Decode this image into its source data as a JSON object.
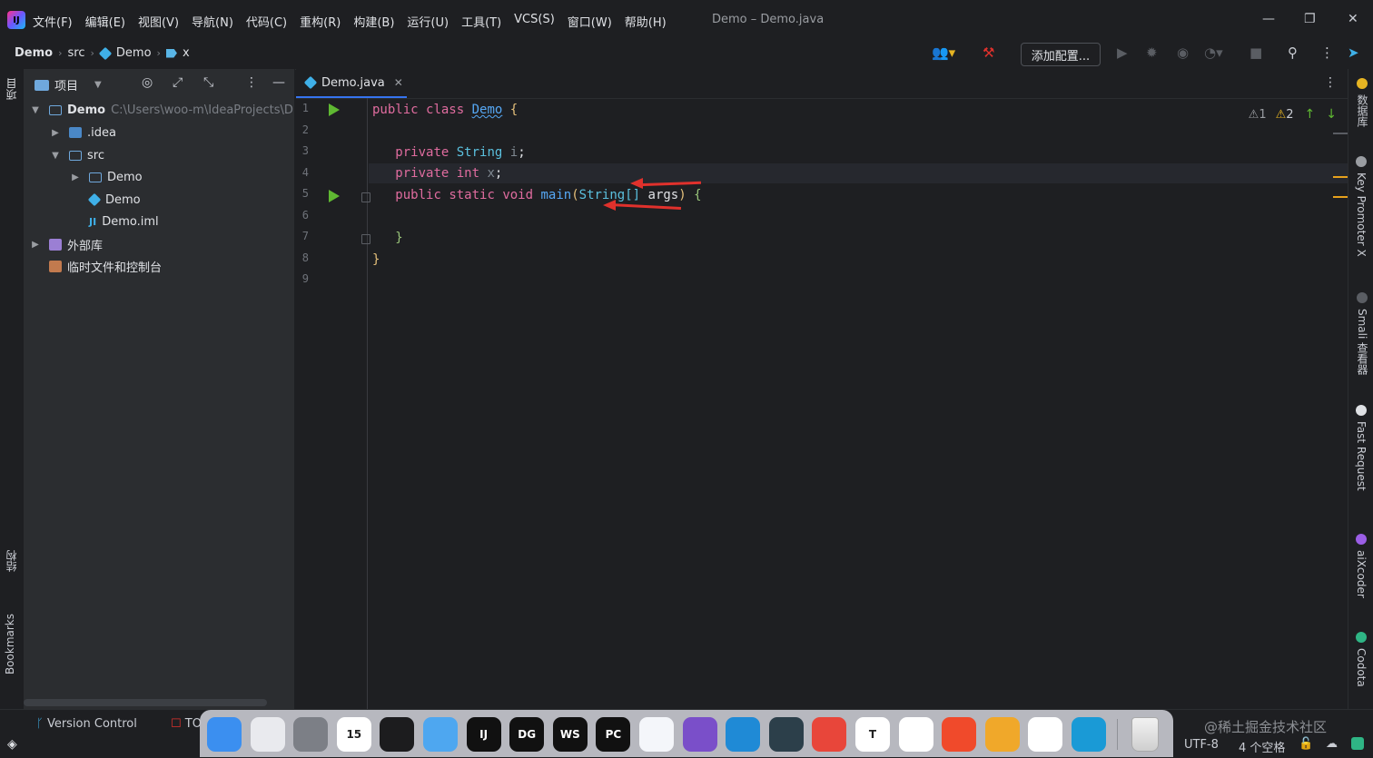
{
  "menu": [
    "文件(F)",
    "编辑(E)",
    "视图(V)",
    "导航(N)",
    "代码(C)",
    "重构(R)",
    "构建(B)",
    "运行(U)",
    "工具(T)",
    "VCS(S)",
    "窗口(W)",
    "帮助(H)"
  ],
  "window_title": "Demo – Demo.java",
  "app_logo": "IJ",
  "breadcrumb": [
    "Demo",
    "src",
    "Demo",
    "x"
  ],
  "toolbar": {
    "add_config_label": "添加配置..."
  },
  "left_strip": {
    "project_label": "项目",
    "structure_label": "结构",
    "bookmarks_label": "Bookmarks"
  },
  "project_panel": {
    "title": "项目",
    "tree": [
      {
        "label": "Demo",
        "path": "C:\\Users\\woo-m\\IdeaProjects\\D",
        "expanded": true
      },
      {
        "label": ".idea"
      },
      {
        "label": "src",
        "expanded": true
      },
      {
        "label": "Demo"
      },
      {
        "label": "Demo"
      },
      {
        "label": "Demo.iml"
      },
      {
        "label": "外部库"
      },
      {
        "label": "临时文件和控制台"
      }
    ]
  },
  "editor": {
    "tab_label": "Demo.java",
    "line_numbers": [
      "1",
      "2",
      "3",
      "4",
      "5",
      "6",
      "7",
      "8",
      "9"
    ],
    "code": {
      "l1_kw1": "public",
      "l1_kw2": "class",
      "l1_cls": "Demo",
      "l1_brace": "{",
      "l3_kw": "private",
      "l3_type": "String",
      "l3_field": "i",
      "l3_semi": ";",
      "l4_kw": "private",
      "l4_type": "int",
      "l4_field": "x",
      "l4_semi": ";",
      "l5_kw1": "public",
      "l5_kw2": "static",
      "l5_kw3": "void",
      "l5_fn": "main",
      "l5_paren": "(",
      "l5_type": "String[]",
      "l5_arg": "args",
      "l5_close": ")",
      "l5_brace": "{",
      "l7_brace": "}",
      "l8_brace": "}"
    },
    "inspections": {
      "weak_warnings": "1",
      "warnings": "2"
    }
  },
  "right_strip": [
    "数据库",
    "Key Promoter X",
    "Smali 查看器",
    "Fast Request",
    "aiXcoder",
    "Codota"
  ],
  "bottom": {
    "version_control": "Version Control",
    "todo": "TO",
    "encoding": "UTF-8",
    "indent": "4 个空格"
  },
  "watermark": "@稀土掘金技术社区",
  "dock": [
    {
      "name": "finder",
      "label": "",
      "color": "#3b8ff0"
    },
    {
      "name": "launchpad",
      "label": "",
      "color": "#e9eaee"
    },
    {
      "name": "system-preferences",
      "label": "",
      "color": "#7c7f86"
    },
    {
      "name": "calendar",
      "label": "15",
      "color": "#ffffff"
    },
    {
      "name": "clock",
      "label": "",
      "color": "#1c1c1e"
    },
    {
      "name": "weather",
      "label": "",
      "color": "#4ea7f0"
    },
    {
      "name": "intellij",
      "label": "IJ",
      "color": "#111111"
    },
    {
      "name": "datagrip",
      "label": "DG",
      "color": "#111111"
    },
    {
      "name": "webstorm",
      "label": "WS",
      "color": "#111111"
    },
    {
      "name": "pycharm",
      "label": "PC",
      "color": "#111111"
    },
    {
      "name": "typora",
      "label": "",
      "color": "#f4f6fa"
    },
    {
      "name": "visual-studio",
      "label": "",
      "color": "#7a4fc9"
    },
    {
      "name": "vscode",
      "label": "",
      "color": "#1f8ad6"
    },
    {
      "name": "terminal-app",
      "label": "",
      "color": "#2c3f4a"
    },
    {
      "name": "red-app",
      "label": "",
      "color": "#e8463a"
    },
    {
      "name": "text-app",
      "label": "T",
      "color": "#ffffff"
    },
    {
      "name": "chrome",
      "label": "",
      "color": "#ffffff"
    },
    {
      "name": "xmind",
      "label": "",
      "color": "#f04a2b"
    },
    {
      "name": "search-app",
      "label": "",
      "color": "#f0a82a"
    },
    {
      "name": "qq",
      "label": "",
      "color": "#ffffff"
    },
    {
      "name": "edge",
      "label": "",
      "color": "#1a9ad6"
    }
  ]
}
